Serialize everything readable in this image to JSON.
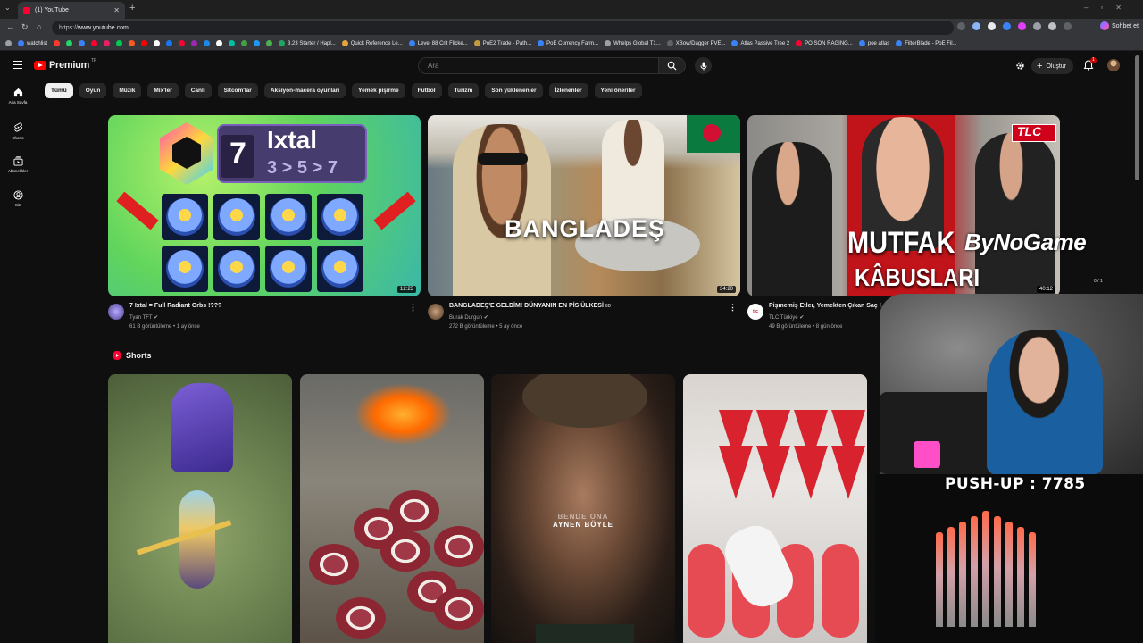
{
  "browser": {
    "tab_title": "(1) YouTube",
    "url_prefix": "https://",
    "url_host": "www.youtube.com",
    "chat_button": "Sohbet et",
    "bookmarks": [
      {
        "label": "watchlist",
        "color": "#3d7eff"
      },
      {
        "label": "3.23 Starter / Hapl...",
        "color": "#21a366"
      },
      {
        "label": "Quick Reference Le...",
        "color": "#e8a33d"
      },
      {
        "label": "Level 88 Crit Flicke...",
        "color": "#3b82f6"
      },
      {
        "label": "PoE2 Trade - Path...",
        "color": "#c49a3c"
      },
      {
        "label": "PoE Currency Farm...",
        "color": "#3b82f6"
      },
      {
        "label": "Whelps Global T1...",
        "color": "#9aa0a6"
      },
      {
        "label": "XBow/Dagger PVE...",
        "color": "#5f6368"
      },
      {
        "label": "Atlas Passive Tree 2",
        "color": "#3b82f6"
      },
      {
        "label": "POISON RAGING...",
        "color": "#ff0033"
      },
      {
        "label": "poe atlas",
        "color": "#3b82f6"
      },
      {
        "label": "FilterBlade - PoE Fil...",
        "color": "#3b82f6"
      }
    ],
    "bookmark_icon_colors": [
      "#ff3b30",
      "#25d366",
      "#3b82f6",
      "#ff0033",
      "#e91e63",
      "#00c853",
      "#ff5722",
      "#ff0000",
      "#ffffff",
      "#1877f2",
      "#ff0033",
      "#9c27b0",
      "#1e88e5",
      "#ffffff",
      "#00bfa5",
      "#43a047",
      "#2196f3",
      "#4caf50"
    ]
  },
  "header": {
    "logo_text": "Premium",
    "region": "TR",
    "search_placeholder": "Ara",
    "create_label": "Oluştur",
    "notification_count": "1"
  },
  "rail": [
    {
      "label": "Ana Sayfa",
      "icon": "home-icon"
    },
    {
      "label": "Shorts",
      "icon": "shorts-icon"
    },
    {
      "label": "Abonelikler",
      "icon": "subscriptions-icon"
    },
    {
      "label": "Siz",
      "icon": "you-icon"
    }
  ],
  "chips": [
    "Tümü",
    "Oyun",
    "Müzik",
    "Mix'ler",
    "Canlı",
    "Sitcom'lar",
    "Aksiyon-macera oyunları",
    "Yemek pişirme",
    "Futbol",
    "Turizm",
    "Son yüklenenler",
    "İzlenenler",
    "Yeni öneriler"
  ],
  "videos": [
    {
      "title": "7 Ixtal = Full Radiant Orbs !???",
      "channel": "Tyan TFT",
      "stats": "61 B görüntüleme • 1 ay önce",
      "duration": "12:23",
      "thumb_text_1": "7",
      "thumb_text_2": "Ixtal",
      "thumb_text_3": "3 > 5 > 7"
    },
    {
      "title": "BANGLADEŞ'E GELDİM! DÜNYANIN EN PİS ÜLKESİ",
      "title_suffix": "8D",
      "channel": "Burak Durgun",
      "stats": "272 B görüntüleme • 5 ay önce",
      "duration": "34:20",
      "thumb_text_1": "BANGLADEŞ"
    },
    {
      "title": "Pişmemiş Etler, Yemekten Çıkan Saç !",
      "channel": "TLC Türkiye",
      "stats": "49 B görüntüleme • 8 gün önce",
      "duration": "40:12",
      "thumb_text_1": "MUTFAK",
      "thumb_text_2": "KÂBUSLARI",
      "thumb_text_3": "TLC",
      "thumb_text_4": "0 / 1",
      "channel_badge": "tlc"
    }
  ],
  "overlay": {
    "watermark": "ByNoGame",
    "pushup": "PUSH-UP : 7785"
  },
  "shorts": {
    "heading": "Shorts",
    "items": [
      {
        "caption": ""
      },
      {
        "caption": ""
      },
      {
        "caption_top": "BENDE ONA",
        "caption_bottom": "AYNEN BÖYLE"
      },
      {
        "caption": ""
      }
    ]
  }
}
